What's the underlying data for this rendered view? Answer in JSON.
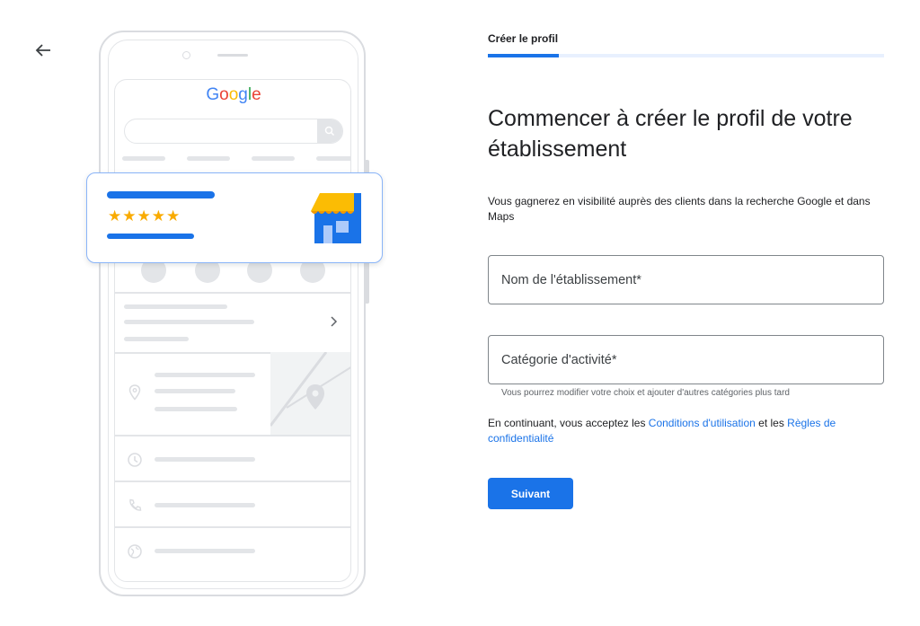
{
  "nav": {
    "back_icon": "arrow-back-icon"
  },
  "illustration": {
    "search_engine": "Google",
    "rating_stars": "★★★★★",
    "brand_colors": {
      "blue": "#4285F4",
      "red": "#EA4335",
      "yellow": "#FBBC05",
      "green": "#34A853"
    }
  },
  "stepper": {
    "label": "Créer le profil",
    "progress": 0.18
  },
  "heading": "Commencer à créer le profil de votre établissement",
  "description": "Vous gagnerez en visibilité auprès des clients dans la recherche Google et dans Maps",
  "form": {
    "business_name": {
      "placeholder": "Nom de l'établissement*",
      "value": ""
    },
    "category": {
      "placeholder": "Catégorie d'activité*",
      "value": ""
    },
    "category_hint": "Vous pourrez modifier votre choix et ajouter d'autres catégories plus tard"
  },
  "consent": {
    "prefix": "En continuant, vous acceptez les ",
    "terms_link": "Conditions d'utilisation",
    "middle": " et les ",
    "privacy_link": "Règles de confidentialité"
  },
  "next_button": "Suivant",
  "colors": {
    "accent": "#1a73e8",
    "track": "#e8f0fe",
    "star": "#f9ab00"
  }
}
